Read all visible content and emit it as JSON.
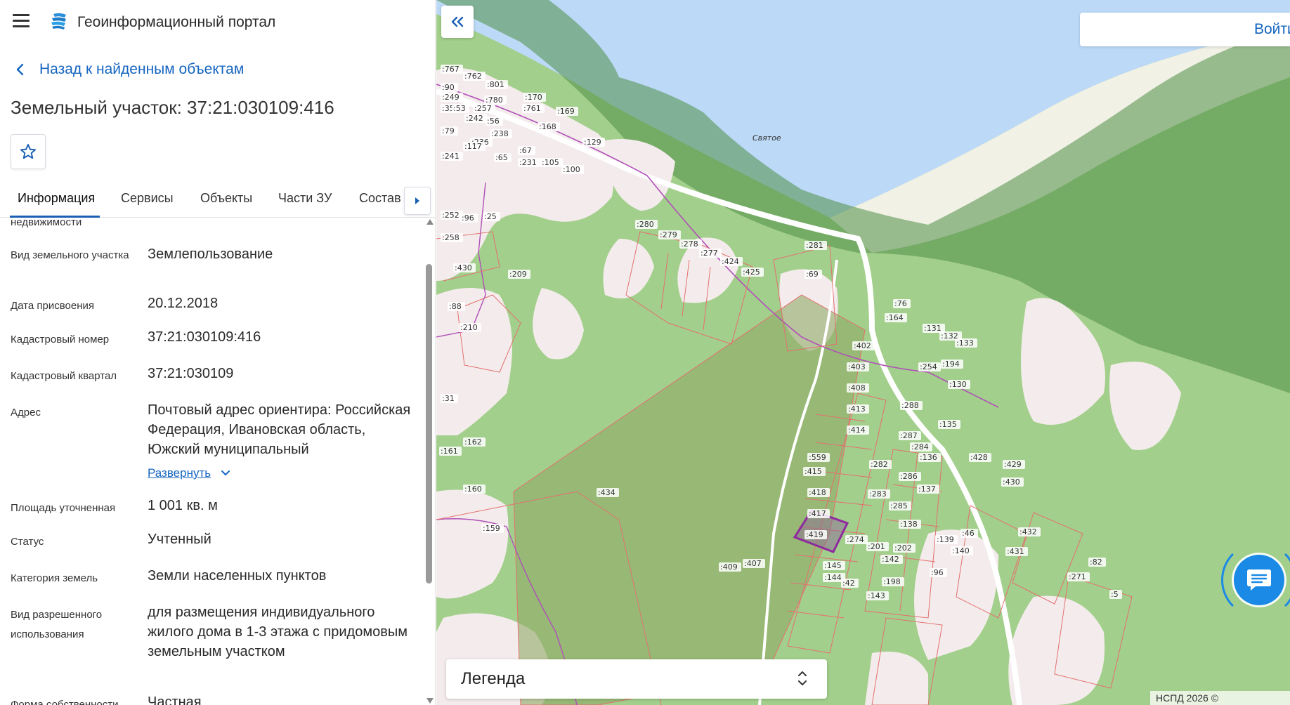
{
  "header": {
    "app_title": "Геоинформационный портал",
    "menu_icon": "hamburger-menu-icon",
    "logo_icon": "portal-logo-icon"
  },
  "back_link": {
    "label": "Назад к найденным объектам",
    "icon": "chevron-left-icon"
  },
  "object_title": "Земельный участок: 37:21:030109:416",
  "favorite": {
    "icon": "star-outline-icon"
  },
  "tabs": [
    {
      "label": "Информация",
      "active": true
    },
    {
      "label": "Сервисы"
    },
    {
      "label": "Объекты"
    },
    {
      "label": "Части ЗУ"
    },
    {
      "label": "Состав"
    }
  ],
  "tabs_next_icon": "caret-right-icon",
  "info": {
    "partial_label": "недвижимости",
    "rows": [
      {
        "label": "Вид земельного участка",
        "value": "Землепользование"
      },
      {
        "label": "Дата присвоения",
        "value": "20.12.2018"
      },
      {
        "label": "Кадастровый номер",
        "value": "37:21:030109:416"
      },
      {
        "label": "Кадастровый квартал",
        "value": "37:21:030109"
      },
      {
        "label": "Адрес",
        "value": "Почтовый адрес ориентира: Российская Федерация, Ивановская область, Южский муниципальный",
        "expand_label": "Развернуть"
      },
      {
        "label": "Площадь уточненная",
        "value": "1 001 кв. м"
      },
      {
        "label": "Статус",
        "value": "Учтенный"
      },
      {
        "label": "Категория земель",
        "value": "Земли населенных пунктов"
      },
      {
        "label": "Вид разрешенного использования",
        "value": "для размещения индивидуального жилого дома в 1-3 этажа с придомовым земельным участком"
      },
      {
        "label": "Форма собственности",
        "value": "Частная"
      }
    ]
  },
  "map": {
    "collapse_icon": "double-chevron-left-icon",
    "login_label": "Войти",
    "legend_label": "Легенда",
    "legend_icon": "expand-updown-icon",
    "chat_icon": "chat-bubble-icon",
    "copyright": "НСПД 2026 ©",
    "lake_label": "Святое",
    "colors": {
      "water": "#bcd9f7",
      "forest": "#a3cf8c",
      "dark_forest": "#5f9a52",
      "settlement": "#f6ecec",
      "parcel_line": "#e46f6f",
      "selected_parcel": "#8e2a9e",
      "road": "#ffffff",
      "power_line": "#b04fb8"
    },
    "parcel_labels": [
      ":767",
      ":762",
      ":801",
      ":90",
      ":249",
      ":780",
      ":170",
      ":35",
      ":53",
      ":257",
      ":761",
      ":169",
      ":242",
      ":56",
      ":79",
      ":238",
      ":168",
      ":236",
      ":117",
      ":129",
      ":67",
      ":65",
      ":241",
      ":231",
      ":105",
      ":100",
      ":252",
      ":96",
      ":25",
      ":280",
      ":279",
      ":258",
      ":278",
      ":277",
      ":281",
      ":424",
      ":430",
      ":209",
      ":425",
      ":69",
      ":88",
      ":76",
      ":164",
      ":210",
      ":131",
      ":132",
      ":133",
      ":402",
      ":403",
      ":254",
      ":194",
      ":408",
      ":130",
      ":31",
      ":413",
      ":288",
      ":414",
      ":135",
      ":287",
      ":162",
      ":161",
      ":559",
      ":284",
      ":136",
      ":428",
      ":429",
      ":282",
      ":415",
      ":286",
      ":430",
      ":160",
      ":434",
      ":418",
      ":137",
      ":283",
      ":285",
      ":417",
      ":138",
      ":159",
      ":419",
      ":274",
      ":201",
      ":202",
      ":139",
      ":46",
      ":432",
      ":140",
      ":142",
      ":431",
      ":409",
      ":407",
      ":145",
      ":144",
      ":42",
      ":198",
      ":96",
      ":82",
      ":271",
      ":143",
      ":5"
    ]
  }
}
